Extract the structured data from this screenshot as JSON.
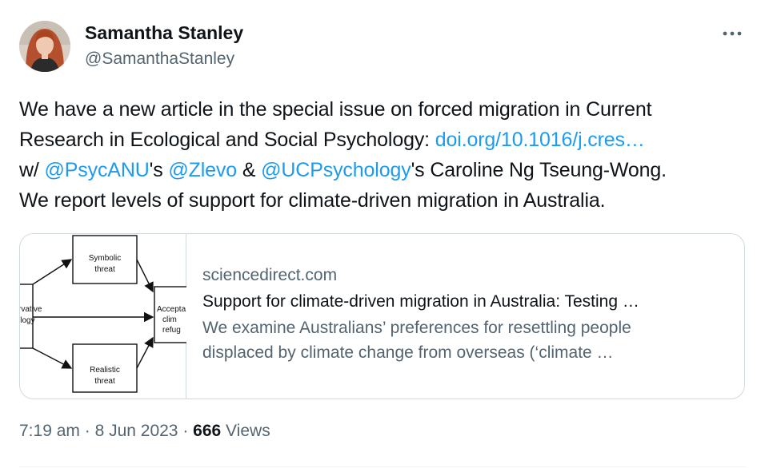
{
  "author": {
    "display_name": "Samantha Stanley",
    "handle": "@SamanthaStanley"
  },
  "tweet": {
    "line1": "We have a new article in the special issue on forced migration in Current",
    "line2_text": "Research in Ecological and Social Psychology: ",
    "line2_link": "doi.org/10.1016/j.cres…",
    "line3_prefix": "w/ ",
    "mention_1": "@PsycANU",
    "suffix_1": "'s ",
    "mention_2": "@Zlevo",
    "connector": " & ",
    "mention_3": "@UCPsychology",
    "suffix_3": "'s Caroline Ng Tseung-Wong.",
    "line4": "We report levels of support for climate-driven migration in Australia."
  },
  "card": {
    "thumbnail": {
      "box_top": [
        "Symbolic",
        "threat"
      ],
      "box_bottom": [
        "Realistic",
        "threat"
      ],
      "box_left": [
        "rvative",
        "ilogy"
      ],
      "box_right": [
        "Accepta",
        "clim",
        "refug"
      ]
    },
    "domain": "sciencedirect.com",
    "title": "Support for climate-driven migration in Australia: Testing …",
    "description_line1": "We examine Australians’ preferences for resettling people",
    "description_line2": "displaced by climate change from overseas (‘climate …"
  },
  "meta": {
    "time": "7:19 am",
    "separator": " · ",
    "date": "8 Jun 2023",
    "views_count": "666",
    "views_label": " Views"
  },
  "icons": {
    "more": "more-horizontal-icon",
    "avatar": "profile-photo"
  },
  "colors": {
    "link": "#1d9bf0",
    "secondary_text": "#536471",
    "primary_text": "#0f1419",
    "border": "#cfd9de"
  }
}
